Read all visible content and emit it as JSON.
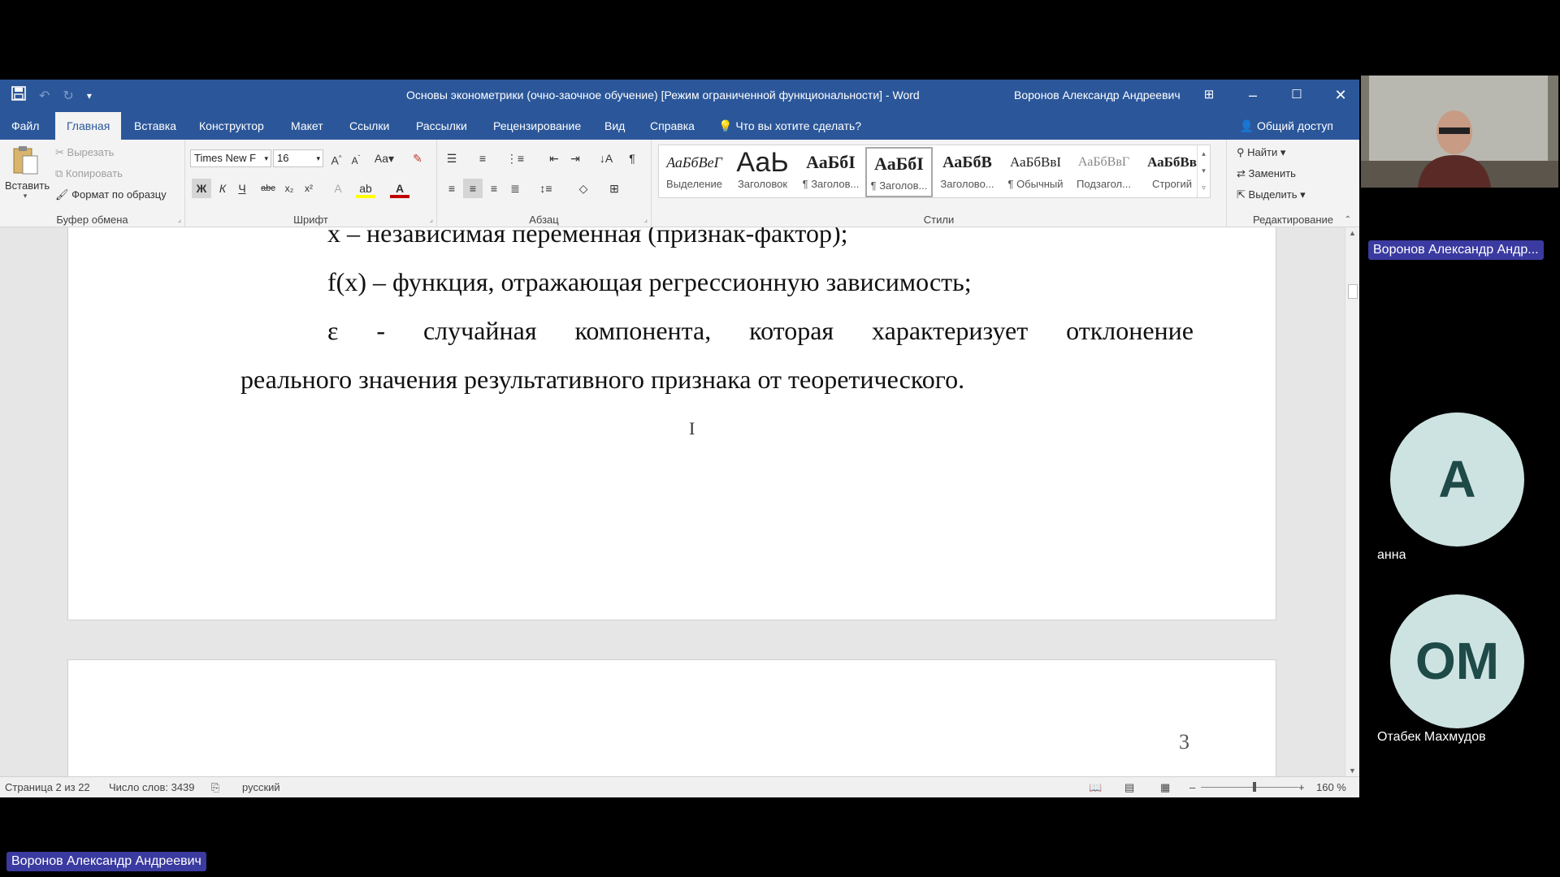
{
  "titlebar": {
    "document_title": "Основы эконометрики (очно-заочное обучение) [Режим ограниченной функциональности]  -  Word",
    "user": "Воронов Александр Андреевич"
  },
  "tabs": [
    {
      "label": "Файл"
    },
    {
      "label": "Главная"
    },
    {
      "label": "Вставка"
    },
    {
      "label": "Конструктор"
    },
    {
      "label": "Макет"
    },
    {
      "label": "Ссылки"
    },
    {
      "label": "Рассылки"
    },
    {
      "label": "Рецензирование"
    },
    {
      "label": "Вид"
    },
    {
      "label": "Справка"
    }
  ],
  "tell_me": "Что вы хотите сделать?",
  "share": "Общий доступ",
  "clipboard": {
    "paste": "Вставить",
    "cut": "Вырезать",
    "copy": "Копировать",
    "format_painter": "Формат по образцу",
    "label": "Буфер обмена"
  },
  "font": {
    "name": "Times New F",
    "size": "16",
    "label": "Шрифт",
    "bold": "Ж",
    "italic": "К",
    "underline": "Ч"
  },
  "paragraph": {
    "label": "Абзац"
  },
  "styles": {
    "label": "Стили",
    "items": [
      {
        "sample": "АаБбВеГ",
        "name": "Выделение"
      },
      {
        "sample": "АаЬ",
        "name": "Заголовок"
      },
      {
        "sample": "АаБбI",
        "name": "¶ Заголов..."
      },
      {
        "sample": "АаБбI",
        "name": "¶ Заголов..."
      },
      {
        "sample": "АаБбВ",
        "name": "Заголово..."
      },
      {
        "sample": "АаБбВвI",
        "name": "¶ Обычный"
      },
      {
        "sample": "АаБбВвГ",
        "name": "Подзагол..."
      },
      {
        "sample": "АаБбВв",
        "name": "Строгий"
      }
    ]
  },
  "editing": {
    "find": "Найти",
    "replace": "Заменить",
    "select": "Выделить",
    "label": "Редактирование"
  },
  "document": {
    "line1": "х – независимая переменная (признак-фактор);",
    "line2": "f(x) – функция, отражающая регрессионную зависимость;",
    "line3_words": [
      "ε",
      "-",
      "случайная",
      "компонента,",
      "которая",
      "характеризует",
      "отклонение"
    ],
    "line4": "реального значения результативного признака от теоретического.",
    "page_number": "3"
  },
  "statusbar": {
    "page": "Страница 2 из 22",
    "words": "Число слов: 3439",
    "language": "русский",
    "zoom": "160 %"
  },
  "participants": {
    "speaker": "Воронов Александр Андр...",
    "p1_initial": "А",
    "p1_name": "анна",
    "p2_initial": "ОМ",
    "p2_name": "Отабек Махмудов",
    "bottom_tag": "Воронов Александр Андреевич"
  },
  "colors": {
    "word_blue": "#2b579a",
    "avatar_bg": "#cde3e2",
    "name_tag_bg": "#3a3aa0"
  }
}
